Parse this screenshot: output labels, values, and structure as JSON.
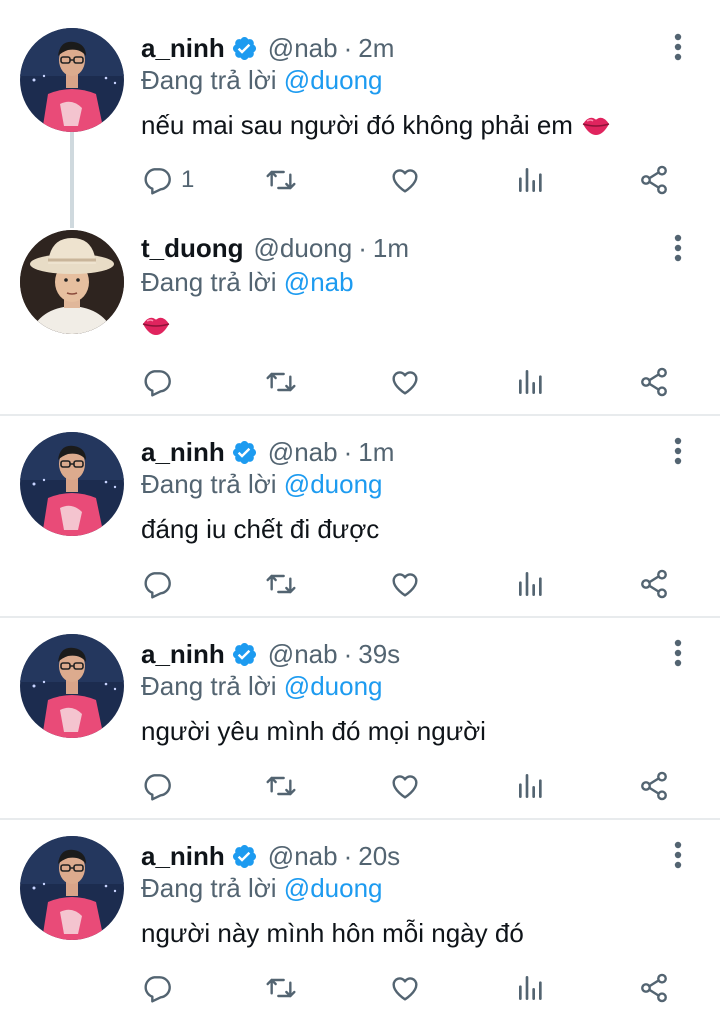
{
  "replying_label": "Đang trả lời",
  "colors": {
    "accent": "#1d9bf0",
    "secondary_text": "#536471",
    "divider": "#e8ebed",
    "kiss": "#e0245e"
  },
  "tweets": [
    {
      "name": "a_ninh",
      "verified": true,
      "handle": "@nab",
      "dot": "·",
      "time": "2m",
      "reply_to": "@duong",
      "text": "nếu mai sau người đó không phải em",
      "emoji": "kiss-mark",
      "reply_count": "1"
    },
    {
      "name": "t_duong",
      "verified": false,
      "handle": "@duong",
      "dot": "·",
      "time": "1m",
      "reply_to": "@nab",
      "text": "",
      "emoji": "kiss-mark",
      "reply_count": ""
    },
    {
      "name": "a_ninh",
      "verified": true,
      "handle": "@nab",
      "dot": "·",
      "time": "1m",
      "reply_to": "@duong",
      "text": "đáng iu chết đi được",
      "emoji": "",
      "reply_count": ""
    },
    {
      "name": "a_ninh",
      "verified": true,
      "handle": "@nab",
      "dot": "·",
      "time": "39s",
      "reply_to": "@duong",
      "text": "người yêu mình đó mọi người",
      "emoji": "",
      "reply_count": ""
    },
    {
      "name": "a_ninh",
      "verified": true,
      "handle": "@nab",
      "dot": "·",
      "time": "20s",
      "reply_to": "@duong",
      "text": "người này mình hôn mỗi ngày đó",
      "emoji": "",
      "reply_count": ""
    }
  ]
}
